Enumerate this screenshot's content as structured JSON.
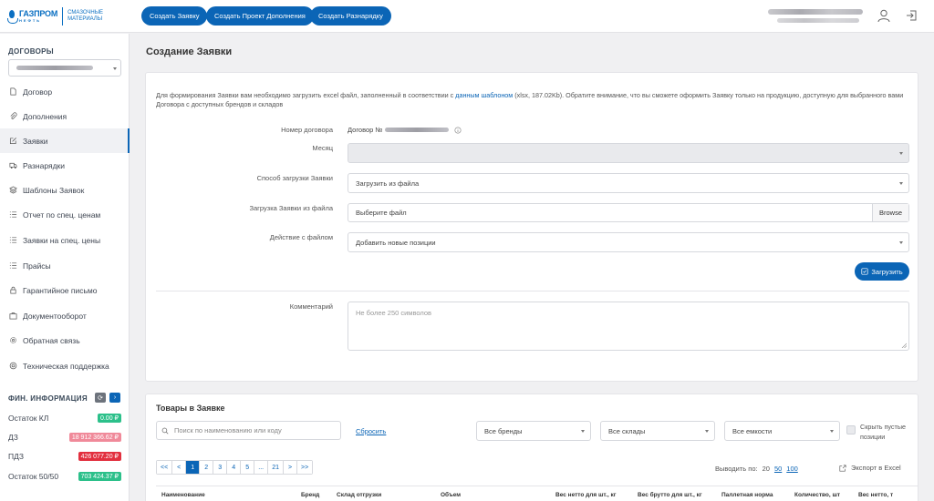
{
  "header": {
    "logo_brand": "ГАЗПРОМ",
    "logo_brand_sub": "НЕФТЬ",
    "logo_tagline": "СМАЗОЧНЫЕ МАТЕРИАЛЫ",
    "buttons": [
      "Создать Заявку",
      "Создать Проект Дополнения",
      "Создать Разнарядку"
    ],
    "icons": [
      "user-icon",
      "logout-icon"
    ]
  },
  "sidebar": {
    "contracts_title": "ДОГОВОРЫ",
    "items": [
      {
        "label": "Договор",
        "icon": "document-icon"
      },
      {
        "label": "Дополнения",
        "icon": "paperclip-icon"
      },
      {
        "label": "Заявки",
        "icon": "edit-icon",
        "active": true
      },
      {
        "label": "Разнарядки",
        "icon": "truck-icon"
      },
      {
        "label": "Шаблоны Заявок",
        "icon": "layers-icon"
      },
      {
        "label": "Отчет по спец. ценам",
        "icon": "list-icon"
      },
      {
        "label": "Заявки на спец. цены",
        "icon": "list-icon"
      },
      {
        "label": "Прайсы",
        "icon": "list-icon"
      },
      {
        "label": "Гарантийное письмо",
        "icon": "lock-icon"
      },
      {
        "label": "Документооборот",
        "icon": "briefcase-icon"
      },
      {
        "label": "Обратная связь",
        "icon": "gear-icon"
      },
      {
        "label": "Техническая поддержка",
        "icon": "lifebuoy-icon"
      }
    ],
    "fin_title": "ФИН. ИНФОРМАЦИЯ",
    "fin_rows": [
      {
        "label": "Остаток КЛ",
        "value": "0.00 ₽",
        "color": "#2cc08a"
      },
      {
        "label": "ДЗ",
        "value": "18 912 366.62 ₽",
        "color": "#f08a9a"
      },
      {
        "label": "ПДЗ",
        "value": "426 077.20 ₽",
        "color": "#e2303f"
      },
      {
        "label": "Остаток 50/50",
        "value": "703 424.37 ₽",
        "color": "#2cc08a"
      }
    ]
  },
  "main": {
    "title": "Создание Заявки",
    "info_before": "Для формирования Заявки вам необходимо загрузить excel файл, заполненный в соответствии с ",
    "info_link": "данным шаблоном",
    "info_after": " (xlsx, 187.02Kb). Обратите внимание, что вы сможете оформить Заявку только на продукцию, доступную для выбранного вами Договора с доступных брендов и складов",
    "form": {
      "contract_label": "Номер договора",
      "contract_value": "Договор №",
      "month_label": "Месяц",
      "method_label": "Способ загрузки Заявки",
      "method_value": "Загрузить из файла",
      "file_label": "Загрузка Заявки из файла",
      "file_placeholder": "Выберите файл",
      "browse_label": "Browse",
      "action_label": "Действие с файлом",
      "action_value": "Добавить новые позиции",
      "upload_label": "Загрузить",
      "comment_label": "Комментарий",
      "comment_placeholder": "Не более 250 символов"
    }
  },
  "products": {
    "title": "Товары в Заявке",
    "search_placeholder": "Поиск по наименованию или коду",
    "reset_label": "Сбросить",
    "filters": [
      "Все бренды",
      "Все склады",
      "Все емкости"
    ],
    "hide_empty_label": "Скрыть пустые позиции",
    "pager": [
      "<<",
      "<",
      "1",
      "2",
      "3",
      "4",
      "5",
      "...",
      "21",
      ">",
      ">>"
    ],
    "current_page": "1",
    "per_page_label": "Выводить по:",
    "per_page_options": [
      "20",
      "50",
      "100"
    ],
    "export_label": "Экспорт в Excel",
    "columns": [
      "Наименование",
      "Бренд",
      "Склад отгрузки",
      "Объем",
      "Вес нетто для шт., кг",
      "Вес брутто для шт., кг",
      "Паллетная норма",
      "Количество, шт",
      "Вес нетто, т"
    ]
  }
}
